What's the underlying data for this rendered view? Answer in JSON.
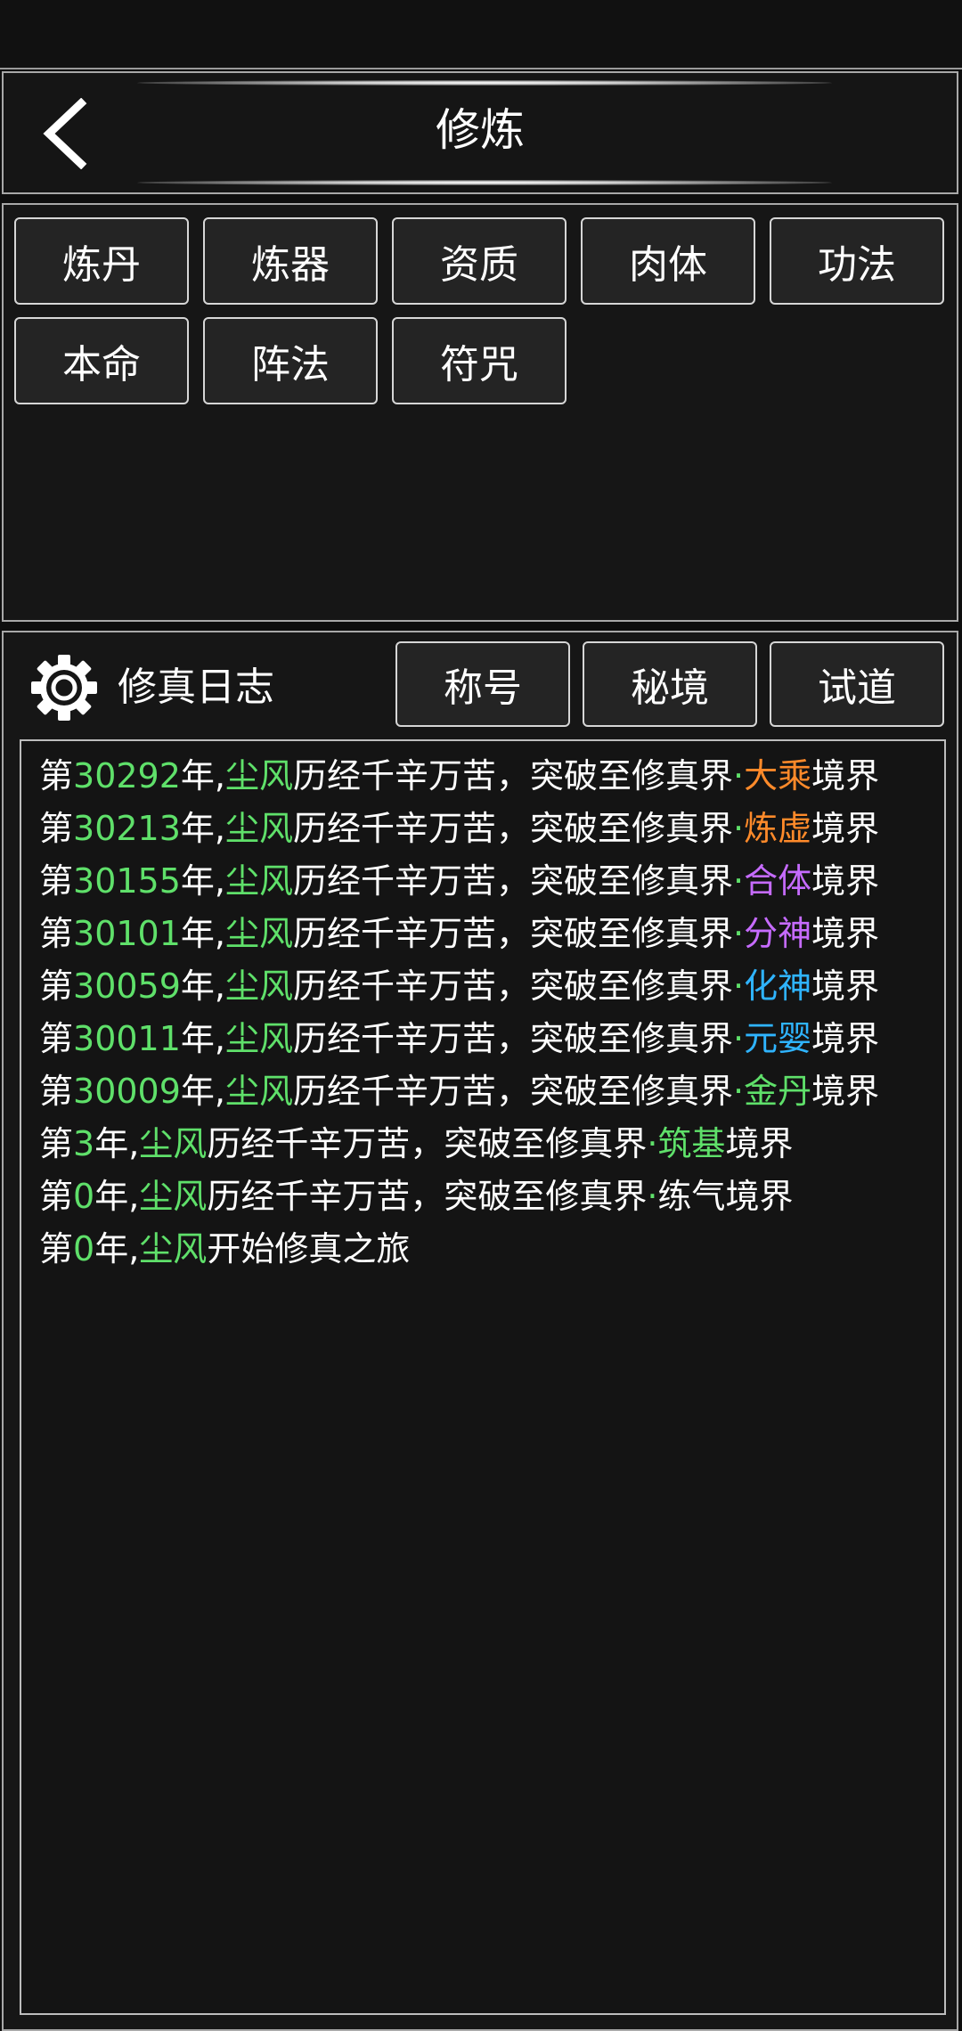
{
  "header": {
    "title": "修炼"
  },
  "skills": [
    "炼丹",
    "炼器",
    "资质",
    "肉体",
    "功法",
    "本命",
    "阵法",
    "符咒"
  ],
  "log": {
    "title": "修真日志",
    "tabs": [
      "称号",
      "秘境",
      "试道"
    ],
    "entries": [
      {
        "prefix": "第",
        "year": "30292",
        "mid": "年,",
        "name": "尘风",
        "text": "历经千辛万苦，突破至修真界",
        "dot": "·",
        "realm": "大乘",
        "realm_color": "#ff8a2a",
        "suffix": "境界"
      },
      {
        "prefix": "第",
        "year": "30213",
        "mid": "年,",
        "name": "尘风",
        "text": "历经千辛万苦，突破至修真界",
        "dot": "·",
        "realm": "炼虚",
        "realm_color": "#ff8a2a",
        "suffix": "境界"
      },
      {
        "prefix": "第",
        "year": "30155",
        "mid": "年,",
        "name": "尘风",
        "text": "历经千辛万苦，突破至修真界",
        "dot": "·",
        "realm": "合体",
        "realm_color": "#c66bff",
        "suffix": "境界"
      },
      {
        "prefix": "第",
        "year": "30101",
        "mid": "年,",
        "name": "尘风",
        "text": "历经千辛万苦，突破至修真界",
        "dot": "·",
        "realm": "分神",
        "realm_color": "#c66bff",
        "suffix": "境界"
      },
      {
        "prefix": "第",
        "year": "30059",
        "mid": "年,",
        "name": "尘风",
        "text": "历经千辛万苦，突破至修真界",
        "dot": "·",
        "realm": "化神",
        "realm_color": "#2fb4ff",
        "suffix": "境界"
      },
      {
        "prefix": "第",
        "year": "30011",
        "mid": "年,",
        "name": "尘风",
        "text": "历经千辛万苦，突破至修真界",
        "dot": "·",
        "realm": "元婴",
        "realm_color": "#2fb4ff",
        "suffix": "境界"
      },
      {
        "prefix": "第",
        "year": "30009",
        "mid": "年,",
        "name": "尘风",
        "text": "历经千辛万苦，突破至修真界",
        "dot": "·",
        "realm": "金丹",
        "realm_color": "#5fe06a",
        "suffix": "境界"
      },
      {
        "prefix": "第",
        "year": "3",
        "mid": "年,",
        "name": "尘风",
        "text": "历经千辛万苦，突破至修真界",
        "dot": "·",
        "realm": "筑基",
        "realm_color": "#5fe06a",
        "suffix": "境界"
      },
      {
        "prefix": "第",
        "year": "0",
        "mid": "年,",
        "name": "尘风",
        "text": "历经千辛万苦，突破至修真界",
        "dot": "·",
        "realm": "练气",
        "realm_color": "#ffffff",
        "suffix": "境界"
      },
      {
        "prefix": "第",
        "year": "0",
        "mid": "年,",
        "name": "尘风",
        "text": "开始修真之旅",
        "dot": "",
        "realm": "",
        "realm_color": "#ffffff",
        "suffix": ""
      }
    ]
  },
  "colors": {
    "highlight_green": "#5fe06a",
    "background": "#161616",
    "border": "#bdbdbd"
  }
}
